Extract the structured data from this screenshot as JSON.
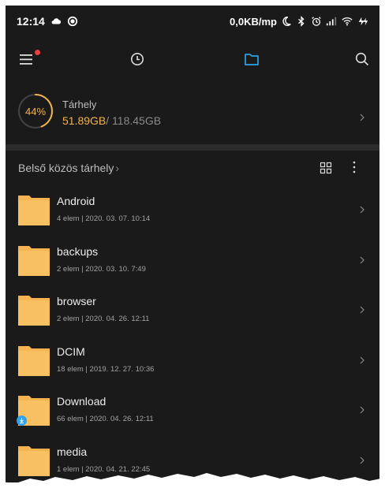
{
  "status": {
    "time": "12:14",
    "speed": "0,0KB/mp"
  },
  "storage": {
    "percent_label": "44%",
    "percent": 44,
    "title": "Tárhely",
    "used": "51.89GB",
    "total": "/ 118.45GB"
  },
  "section": {
    "title": "Belső közös tárhely",
    "chevron": "›"
  },
  "folders": [
    {
      "name": "Android",
      "meta": "4 elem  |  2020. 03. 07. 10:14",
      "badge": false
    },
    {
      "name": "backups",
      "meta": "2 elem  |  2020. 03. 10. 7:49",
      "badge": false
    },
    {
      "name": "browser",
      "meta": "2 elem  |  2020. 04. 26. 12:11",
      "badge": false
    },
    {
      "name": "DCIM",
      "meta": "18 elem  |  2019. 12. 27. 10:36",
      "badge": false
    },
    {
      "name": "Download",
      "meta": "66 elem  |  2020. 04. 26. 12:11",
      "badge": true
    },
    {
      "name": "media",
      "meta": "1 elem  |  2020. 04. 21. 22:45",
      "badge": false
    }
  ],
  "colors": {
    "background": "#1a1a1a",
    "accent": "#f0b44c",
    "active_tab": "#2fa2e8",
    "folder": "#f5b451",
    "badge": "#e8413c"
  },
  "icons": {
    "menu": "hamburger-menu-icon",
    "recent": "clock-icon",
    "files": "folder-icon",
    "search": "search-icon",
    "grid": "grid-view-icon",
    "more": "more-vertical-icon",
    "chevron": "chevron-right-icon"
  }
}
